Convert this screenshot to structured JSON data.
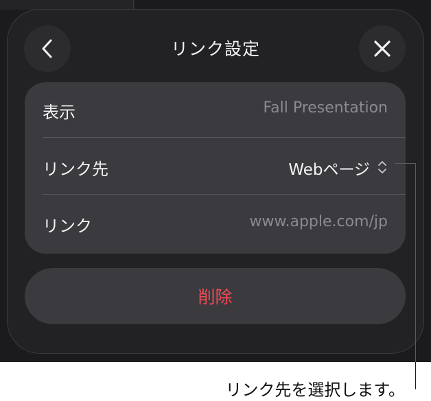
{
  "header": {
    "title": "リンク設定",
    "back_icon": "chevron-left-icon",
    "close_icon": "close-icon"
  },
  "rows": [
    {
      "label": "表示",
      "value": "Fall Presentation"
    },
    {
      "label": "リンク先",
      "value": "Webページ",
      "icon": "up-down-chevron-icon"
    },
    {
      "label": "リンク",
      "value": "www.apple.com/jp"
    }
  ],
  "delete_label": "削除",
  "callout": "リンク先を選択します。",
  "colors": {
    "background": "#1b1b1d",
    "sheet": "#222224",
    "card": "#3b3b3f",
    "delete": "#f04a54",
    "text": "#f2f2f4",
    "placeholder": "#8a8a8f"
  }
}
